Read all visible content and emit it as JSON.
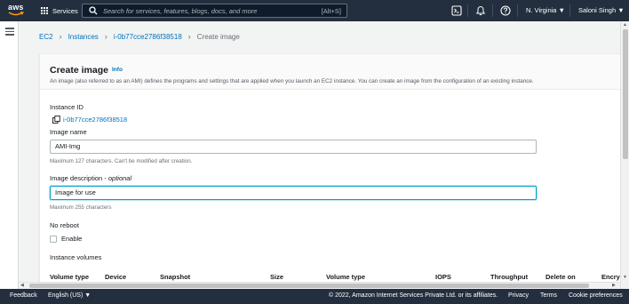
{
  "topnav": {
    "logo": "aws",
    "services_label": "Services",
    "search_placeholder": "Search for services, features, blogs, docs, and more",
    "search_shortcut": "[Alt+S]",
    "region": "N. Virginia ▼",
    "user": "Saloni Singh ▼"
  },
  "breadcrumb": {
    "items": [
      "EC2",
      "Instances",
      "i-0b77cce2786f38518"
    ],
    "current": "Create image"
  },
  "page": {
    "title": "Create image",
    "info": "Info",
    "description": "An image (also referred to as an AMI) defines the programs and settings that are applied when you launch an EC2 instance. You can create an image from the configuration of an existing instance."
  },
  "form": {
    "instance_id_label": "Instance ID",
    "instance_id_value": "i-0b77cce2786f38518",
    "image_name_label": "Image name",
    "image_name_value": "AMI-Img",
    "image_name_hint": "Maximum 127 characters. Can't be modified after creation.",
    "image_desc_label": "Image description - ",
    "image_desc_optional": "optional",
    "image_desc_value": "Image for use",
    "image_desc_hint": "Maximum 255 characters",
    "no_reboot_label": "No reboot",
    "enable_label": "Enable",
    "instance_volumes_label": "Instance volumes"
  },
  "volumes_table": {
    "columns": [
      "Volume type",
      "Device",
      "Snapshot",
      "Size",
      "Volume type",
      "IOPS",
      "Throughput",
      "Delete on",
      "Encry"
    ]
  },
  "footer": {
    "feedback": "Feedback",
    "language": "English (US) ▼",
    "copyright": "© 2022, Amazon Internet Services Private Ltd. or its affiliates.",
    "privacy": "Privacy",
    "terms": "Terms",
    "cookies": "Cookie preferences"
  },
  "colors": {
    "nav_bg": "#232f3e",
    "link": "#0073bb",
    "focus": "#00a1c9"
  }
}
